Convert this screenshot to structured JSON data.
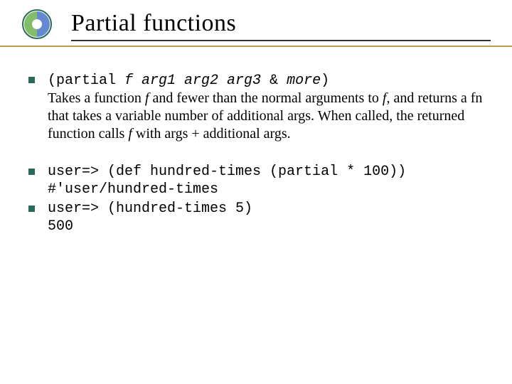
{
  "title": "Partial functions",
  "bullet1": {
    "sig_open": "(partial ",
    "sig_args": "f arg1 arg2 arg3 ",
    "sig_amp": "& ",
    "sig_more": "more",
    "sig_close": ")",
    "desc_a": "Takes a function ",
    "desc_f1": "f",
    "desc_b": " and fewer than the normal arguments to ",
    "desc_f2": "f",
    "desc_c": ", and returns a fn that takes a variable number of additional args. When called, the returned function calls ",
    "desc_f3": "f",
    "desc_d": " with args + additional args."
  },
  "bullet2": {
    "line1": "user=> (def hundred-times (partial * 100))",
    "line2": "#'user/hundred-times"
  },
  "bullet3": {
    "line1": "user=> (hundred-times 5)",
    "line2": "500"
  },
  "colors": {
    "bullet": "#2a6a5a",
    "accent_rule": "#bfa04a"
  }
}
